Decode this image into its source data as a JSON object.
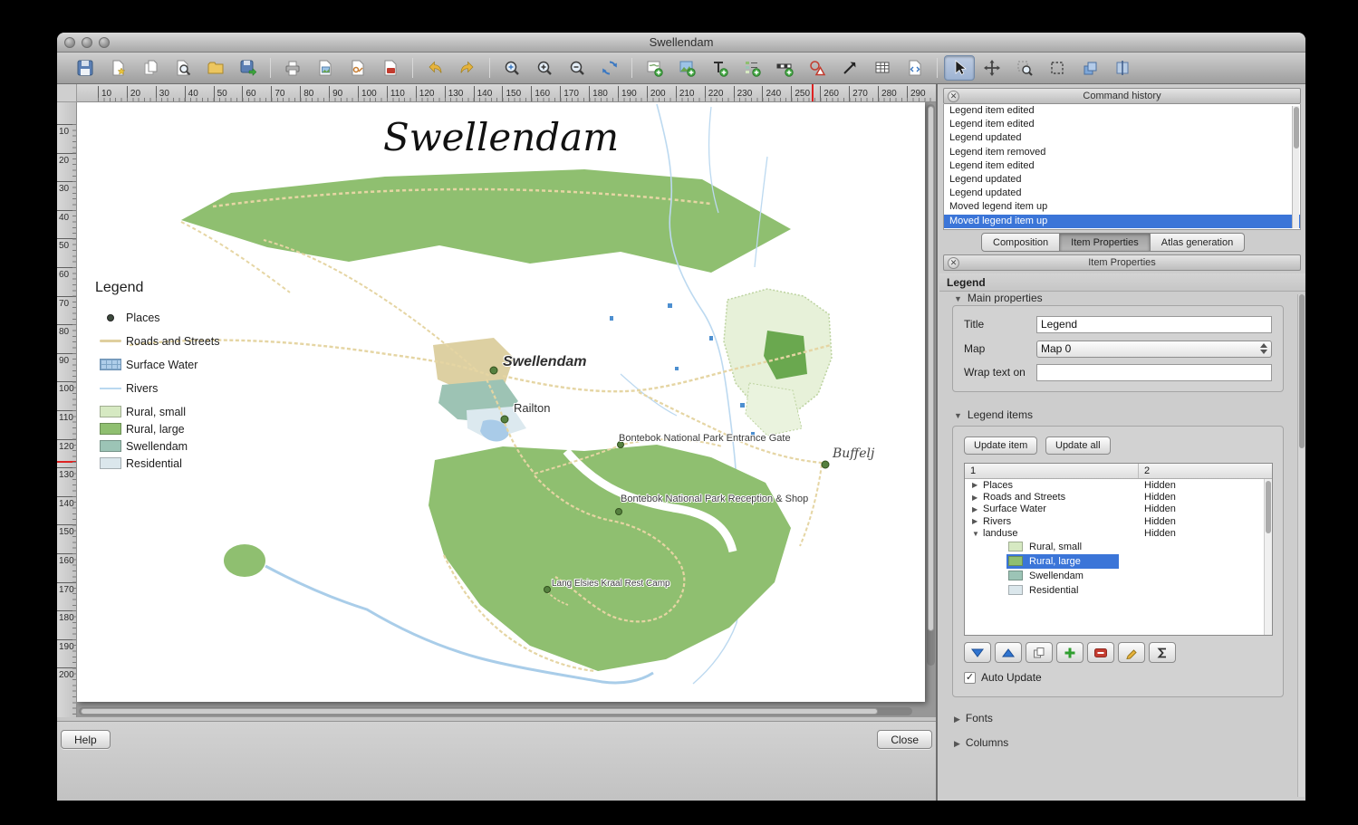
{
  "window": {
    "title": "Swellendam"
  },
  "toolbar": {
    "icons": [
      "save",
      "new-composition",
      "duplicate-composition",
      "composer-manager",
      "open-template",
      "save-as-template",
      "print",
      "export-image",
      "export-svg",
      "export-pdf",
      "undo",
      "redo",
      "zoom-full",
      "zoom-in",
      "zoom-out",
      "refresh-view",
      "add-map",
      "add-image",
      "add-label",
      "add-legend",
      "add-scalebar",
      "add-shape",
      "add-arrow",
      "add-table",
      "add-html",
      "select-move-item",
      "move-item-content",
      "zoom-to-item",
      "select-frame",
      "raise-items",
      "align-items"
    ]
  },
  "rulers": {
    "horizontal": [
      "10",
      "20",
      "30",
      "40",
      "50",
      "60",
      "70",
      "80",
      "90",
      "100",
      "110",
      "120",
      "130",
      "140",
      "150",
      "160",
      "170",
      "180",
      "190",
      "200",
      "210",
      "220",
      "230",
      "240",
      "250",
      "260",
      "270",
      "280",
      "290"
    ],
    "vertical": [
      "10",
      "20",
      "30",
      "40",
      "50",
      "60",
      "70",
      "80",
      "90",
      "100",
      "110",
      "120",
      "130",
      "140",
      "150",
      "160",
      "170",
      "180",
      "190",
      "200"
    ]
  },
  "canvas": {
    "map_title": "Swellendam",
    "legend": {
      "title": "Legend",
      "items": [
        {
          "label": "Places",
          "symbol": "point",
          "color": "#3d4a3d"
        },
        {
          "label": "Roads and Streets",
          "symbol": "line",
          "color": "#dfcf9e"
        },
        {
          "label": "Surface Water",
          "symbol": "grid-fill",
          "color": "#aecde9"
        },
        {
          "label": "Rivers",
          "symbol": "line",
          "color": "#b9d8f0"
        },
        {
          "label": "Rural, small",
          "symbol": "fill",
          "color": "#d6e9c2"
        },
        {
          "label": "Rural, large",
          "symbol": "fill",
          "color": "#8fbf70"
        },
        {
          "label": "Swellendam",
          "symbol": "fill",
          "color": "#9cc4b6"
        },
        {
          "label": "Residential",
          "symbol": "fill",
          "color": "#dbe7ec"
        }
      ]
    },
    "labels": [
      "Swellendam",
      "Railton",
      "Bontebok National Park Entrance Gate",
      "Buffelj",
      "Bontebok National Park Reception & Shop",
      "Lang Elsies Kraal Rest Camp"
    ]
  },
  "command_history": {
    "title": "Command history",
    "items": [
      "Legend item edited",
      "Legend item edited",
      "Legend updated",
      "Legend item removed",
      "Legend item edited",
      "Legend updated",
      "Legend updated",
      "Moved legend item up",
      "Moved legend item up"
    ],
    "selected": "Moved legend item up"
  },
  "tabs": {
    "items": [
      {
        "label": "Composition"
      },
      {
        "label": "Item Properties"
      },
      {
        "label": "Atlas generation"
      }
    ],
    "active": "Item Properties"
  },
  "item_properties": {
    "panel_title": "Item Properties",
    "item_type": "Legend",
    "main_properties_label": "Main properties",
    "fields": {
      "title_label": "Title",
      "title_value": "Legend",
      "map_label": "Map",
      "map_value": "Map 0",
      "wrap_label": "Wrap text on",
      "wrap_value": ""
    },
    "legend_items_label": "Legend items",
    "update_item_label": "Update item",
    "update_all_label": "Update all",
    "tree": {
      "columns": [
        "1",
        "2"
      ],
      "rows": [
        {
          "label": "Places",
          "value": "Hidden"
        },
        {
          "label": "Roads and Streets",
          "value": "Hidden"
        },
        {
          "label": "Surface Water",
          "value": "Hidden"
        },
        {
          "label": "Rivers",
          "value": "Hidden"
        },
        {
          "label": "landuse",
          "value": "Hidden"
        }
      ],
      "children": [
        {
          "label": "Rural, small",
          "color": "#d6e9c2"
        },
        {
          "label": "Rural, large",
          "color": "#8fbf70",
          "selected": true
        },
        {
          "label": "Swellendam",
          "color": "#9cc4b6"
        },
        {
          "label": "Residential",
          "color": "#dbe7ec"
        }
      ]
    },
    "auto_update_label": "Auto Update",
    "fonts_label": "Fonts",
    "columns_label": "Columns"
  },
  "footer": {
    "help_label": "Help",
    "close_label": "Close"
  }
}
